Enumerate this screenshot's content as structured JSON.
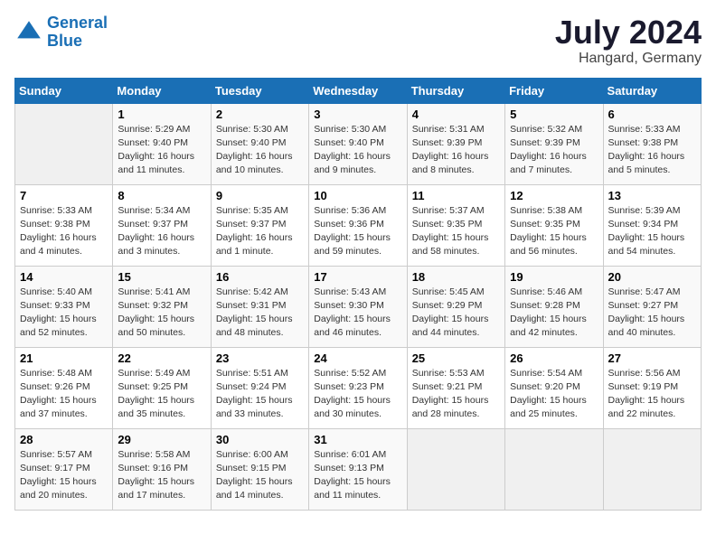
{
  "header": {
    "logo_line1": "General",
    "logo_line2": "Blue",
    "month_year": "July 2024",
    "location": "Hangard, Germany"
  },
  "weekdays": [
    "Sunday",
    "Monday",
    "Tuesday",
    "Wednesday",
    "Thursday",
    "Friday",
    "Saturday"
  ],
  "weeks": [
    [
      {
        "day": "",
        "empty": true
      },
      {
        "day": "1",
        "sunrise": "Sunrise: 5:29 AM",
        "sunset": "Sunset: 9:40 PM",
        "daylight": "Daylight: 16 hours and 11 minutes."
      },
      {
        "day": "2",
        "sunrise": "Sunrise: 5:30 AM",
        "sunset": "Sunset: 9:40 PM",
        "daylight": "Daylight: 16 hours and 10 minutes."
      },
      {
        "day": "3",
        "sunrise": "Sunrise: 5:30 AM",
        "sunset": "Sunset: 9:40 PM",
        "daylight": "Daylight: 16 hours and 9 minutes."
      },
      {
        "day": "4",
        "sunrise": "Sunrise: 5:31 AM",
        "sunset": "Sunset: 9:39 PM",
        "daylight": "Daylight: 16 hours and 8 minutes."
      },
      {
        "day": "5",
        "sunrise": "Sunrise: 5:32 AM",
        "sunset": "Sunset: 9:39 PM",
        "daylight": "Daylight: 16 hours and 7 minutes."
      },
      {
        "day": "6",
        "sunrise": "Sunrise: 5:33 AM",
        "sunset": "Sunset: 9:38 PM",
        "daylight": "Daylight: 16 hours and 5 minutes."
      }
    ],
    [
      {
        "day": "7",
        "sunrise": "Sunrise: 5:33 AM",
        "sunset": "Sunset: 9:38 PM",
        "daylight": "Daylight: 16 hours and 4 minutes."
      },
      {
        "day": "8",
        "sunrise": "Sunrise: 5:34 AM",
        "sunset": "Sunset: 9:37 PM",
        "daylight": "Daylight: 16 hours and 3 minutes."
      },
      {
        "day": "9",
        "sunrise": "Sunrise: 5:35 AM",
        "sunset": "Sunset: 9:37 PM",
        "daylight": "Daylight: 16 hours and 1 minute."
      },
      {
        "day": "10",
        "sunrise": "Sunrise: 5:36 AM",
        "sunset": "Sunset: 9:36 PM",
        "daylight": "Daylight: 15 hours and 59 minutes."
      },
      {
        "day": "11",
        "sunrise": "Sunrise: 5:37 AM",
        "sunset": "Sunset: 9:35 PM",
        "daylight": "Daylight: 15 hours and 58 minutes."
      },
      {
        "day": "12",
        "sunrise": "Sunrise: 5:38 AM",
        "sunset": "Sunset: 9:35 PM",
        "daylight": "Daylight: 15 hours and 56 minutes."
      },
      {
        "day": "13",
        "sunrise": "Sunrise: 5:39 AM",
        "sunset": "Sunset: 9:34 PM",
        "daylight": "Daylight: 15 hours and 54 minutes."
      }
    ],
    [
      {
        "day": "14",
        "sunrise": "Sunrise: 5:40 AM",
        "sunset": "Sunset: 9:33 PM",
        "daylight": "Daylight: 15 hours and 52 minutes."
      },
      {
        "day": "15",
        "sunrise": "Sunrise: 5:41 AM",
        "sunset": "Sunset: 9:32 PM",
        "daylight": "Daylight: 15 hours and 50 minutes."
      },
      {
        "day": "16",
        "sunrise": "Sunrise: 5:42 AM",
        "sunset": "Sunset: 9:31 PM",
        "daylight": "Daylight: 15 hours and 48 minutes."
      },
      {
        "day": "17",
        "sunrise": "Sunrise: 5:43 AM",
        "sunset": "Sunset: 9:30 PM",
        "daylight": "Daylight: 15 hours and 46 minutes."
      },
      {
        "day": "18",
        "sunrise": "Sunrise: 5:45 AM",
        "sunset": "Sunset: 9:29 PM",
        "daylight": "Daylight: 15 hours and 44 minutes."
      },
      {
        "day": "19",
        "sunrise": "Sunrise: 5:46 AM",
        "sunset": "Sunset: 9:28 PM",
        "daylight": "Daylight: 15 hours and 42 minutes."
      },
      {
        "day": "20",
        "sunrise": "Sunrise: 5:47 AM",
        "sunset": "Sunset: 9:27 PM",
        "daylight": "Daylight: 15 hours and 40 minutes."
      }
    ],
    [
      {
        "day": "21",
        "sunrise": "Sunrise: 5:48 AM",
        "sunset": "Sunset: 9:26 PM",
        "daylight": "Daylight: 15 hours and 37 minutes."
      },
      {
        "day": "22",
        "sunrise": "Sunrise: 5:49 AM",
        "sunset": "Sunset: 9:25 PM",
        "daylight": "Daylight: 15 hours and 35 minutes."
      },
      {
        "day": "23",
        "sunrise": "Sunrise: 5:51 AM",
        "sunset": "Sunset: 9:24 PM",
        "daylight": "Daylight: 15 hours and 33 minutes."
      },
      {
        "day": "24",
        "sunrise": "Sunrise: 5:52 AM",
        "sunset": "Sunset: 9:23 PM",
        "daylight": "Daylight: 15 hours and 30 minutes."
      },
      {
        "day": "25",
        "sunrise": "Sunrise: 5:53 AM",
        "sunset": "Sunset: 9:21 PM",
        "daylight": "Daylight: 15 hours and 28 minutes."
      },
      {
        "day": "26",
        "sunrise": "Sunrise: 5:54 AM",
        "sunset": "Sunset: 9:20 PM",
        "daylight": "Daylight: 15 hours and 25 minutes."
      },
      {
        "day": "27",
        "sunrise": "Sunrise: 5:56 AM",
        "sunset": "Sunset: 9:19 PM",
        "daylight": "Daylight: 15 hours and 22 minutes."
      }
    ],
    [
      {
        "day": "28",
        "sunrise": "Sunrise: 5:57 AM",
        "sunset": "Sunset: 9:17 PM",
        "daylight": "Daylight: 15 hours and 20 minutes."
      },
      {
        "day": "29",
        "sunrise": "Sunrise: 5:58 AM",
        "sunset": "Sunset: 9:16 PM",
        "daylight": "Daylight: 15 hours and 17 minutes."
      },
      {
        "day": "30",
        "sunrise": "Sunrise: 6:00 AM",
        "sunset": "Sunset: 9:15 PM",
        "daylight": "Daylight: 15 hours and 14 minutes."
      },
      {
        "day": "31",
        "sunrise": "Sunrise: 6:01 AM",
        "sunset": "Sunset: 9:13 PM",
        "daylight": "Daylight: 15 hours and 11 minutes."
      },
      {
        "day": "",
        "empty": true
      },
      {
        "day": "",
        "empty": true
      },
      {
        "day": "",
        "empty": true
      }
    ]
  ]
}
